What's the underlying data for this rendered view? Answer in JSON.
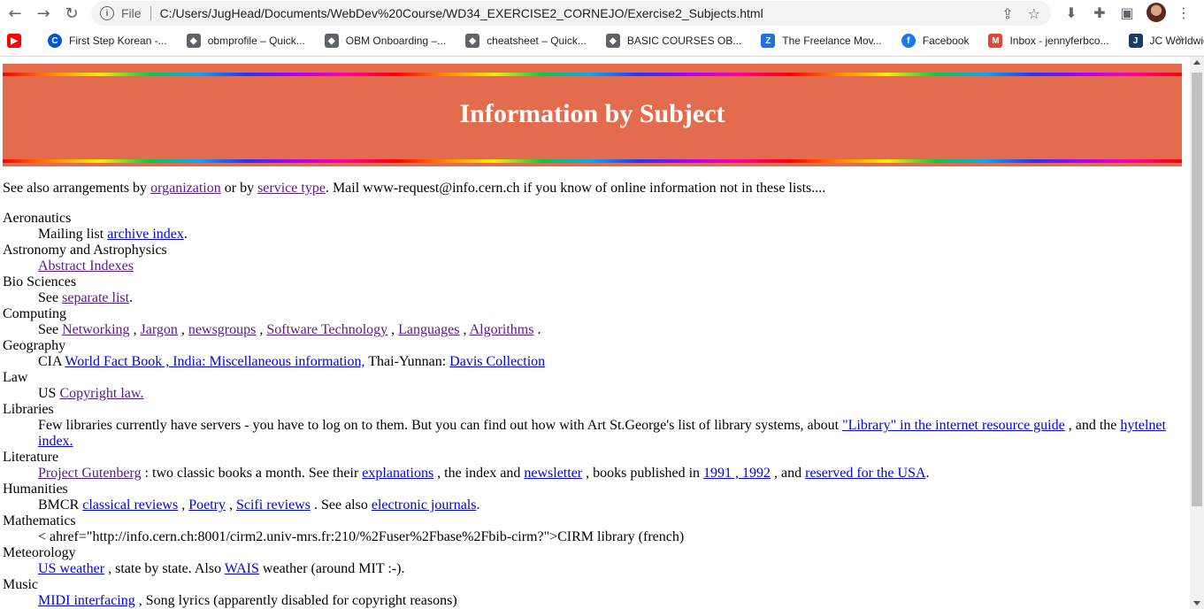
{
  "browser": {
    "scheme": "File",
    "url": "C:/Users/JugHead/Documents/WebDev%20Course/WD34_EXERCISE2_CORNEJO/Exercise2_Subjects.html"
  },
  "bookmarks": [
    {
      "label": "",
      "icon": "youtube-icon",
      "color": "#ff0000"
    },
    {
      "label": "First Step Korean -...",
      "icon": "coursera-icon",
      "color": "#0056d2"
    },
    {
      "label": "obmprofile – Quick...",
      "icon": "shield-icon",
      "color": "#5f6368"
    },
    {
      "label": "OBM Onboarding –...",
      "icon": "shield-icon",
      "color": "#5f6368"
    },
    {
      "label": "cheatsheet – Quick...",
      "icon": "shield-icon",
      "color": "#5f6368"
    },
    {
      "label": "BASIC COURSES OB...",
      "icon": "shield-icon",
      "color": "#5f6368"
    },
    {
      "label": "The Freelance Mov...",
      "icon": "freelance-icon",
      "color": "#1a73e8"
    },
    {
      "label": "Facebook",
      "icon": "facebook-icon",
      "color": "#1877f2"
    },
    {
      "label": "Inbox - jennyferbco...",
      "icon": "gmail-icon",
      "color": "#ea4335"
    },
    {
      "label": "JC Worldwide",
      "icon": "jc-icon",
      "color": "#1a3a6b"
    }
  ],
  "page": {
    "title": "Information by Subject",
    "intro": {
      "t1": "See also arrangements by ",
      "l1": "organization",
      "t2": " or by ",
      "l2": "service type",
      "t3": ". Mail www-request@info.cern.ch if you know of online information not in these lists...."
    },
    "subjects": {
      "aeronautics": {
        "term": "Aeronautics",
        "t1": "Mailing list ",
        "l1": "archive index",
        "t2": "."
      },
      "astronomy": {
        "term": "Astronomy and Astrophysics",
        "l1": "Abstract Indexes"
      },
      "bio": {
        "term": "Bio Sciences",
        "t1": "See ",
        "l1": "separate list",
        "t2": "."
      },
      "computing": {
        "term": "Computing",
        "t1": "See ",
        "l1": "Networking",
        "l2": "Jargon",
        "l3": "newsgroups",
        "l4": "Software Technology",
        "l5": "Languages",
        "l6": "Algorithms",
        "sep": " , ",
        "end": " ."
      },
      "geography": {
        "term": "Geography",
        "t1": "CIA ",
        "l1": "World Fact Book , India: Miscellaneous information,",
        "t2": " Thai-Yunnan: ",
        "l2": "Davis Collection"
      },
      "law": {
        "term": "Law",
        "t1": "US ",
        "l1": "Copyright law."
      },
      "libraries": {
        "term": "Libraries",
        "t1": "Few libraries currently have servers - you have to log on to them. But you can find out how with Art St.George's list of library systems, about ",
        "l1": "\"Library\" in the internet resource guide",
        "t2": " , and the ",
        "l2": "hytelnet index."
      },
      "literature": {
        "term": "Literature",
        "l1": "Project Gutenberg",
        "t1": " : two classic books a month. See their ",
        "l2": "explanations",
        "t2": " , the index and ",
        "l3": "newsletter",
        "t3": " , books published in ",
        "l4": "1991 , 1992",
        "t4": " , and ",
        "l5": "reserved for the USA",
        "t5": "."
      },
      "humanities": {
        "term": "Humanities",
        "t1": "BMCR ",
        "l1": "classical reviews",
        "t2": " , ",
        "l2": "Poetry",
        "t3": " , ",
        "l3": "Scifi reviews",
        "t4": " . See also ",
        "l4": "electronic journals",
        "t5": "."
      },
      "mathematics": {
        "term": "Mathematics",
        "t1": "< ahref=\"http://info.cern.ch:8001/cirm2.univ-mrs.fr:210/%2Fuser%2Fbase%2Fbib-cirm?\">CIRM library (french)"
      },
      "meteorology": {
        "term": "Meteorology",
        "l1": "US weather",
        "t1": " , state by state. Also ",
        "l2": "WAIS",
        "t2": " weather (around MIT :-)."
      },
      "music": {
        "term": "Music",
        "l1": "MIDI interfacing",
        "t1": " , Song lyrics (apparently disabled for copyright reasons)"
      }
    }
  },
  "colors": {
    "banner": "#e36b4e",
    "link": "#0000ee",
    "visited": "#551a8b"
  }
}
